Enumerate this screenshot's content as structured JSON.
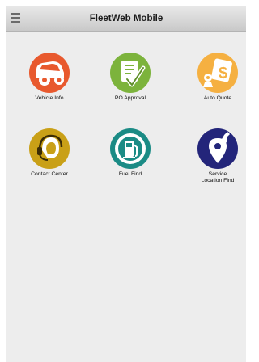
{
  "header": {
    "title": "FleetWeb Mobile",
    "menu_icon": "hamburger-menu-icon"
  },
  "tiles": [
    {
      "label": "Vehicle Info",
      "icon": "car-icon",
      "color": "#e8592e"
    },
    {
      "label": "PO Approval",
      "icon": "checklist-icon",
      "color": "#7cb33c"
    },
    {
      "label": "Auto Quote",
      "icon": "money-quote-icon",
      "color": "#f5b041"
    },
    {
      "label": "Contact Center",
      "icon": "headset-icon",
      "color": "#c9a017"
    },
    {
      "label": "Fuel Find",
      "icon": "fuel-pump-icon",
      "color": "#1b8b85"
    },
    {
      "label": "Service\nLocation Find",
      "icon": "wrench-location-icon",
      "color": "#23257a"
    }
  ]
}
